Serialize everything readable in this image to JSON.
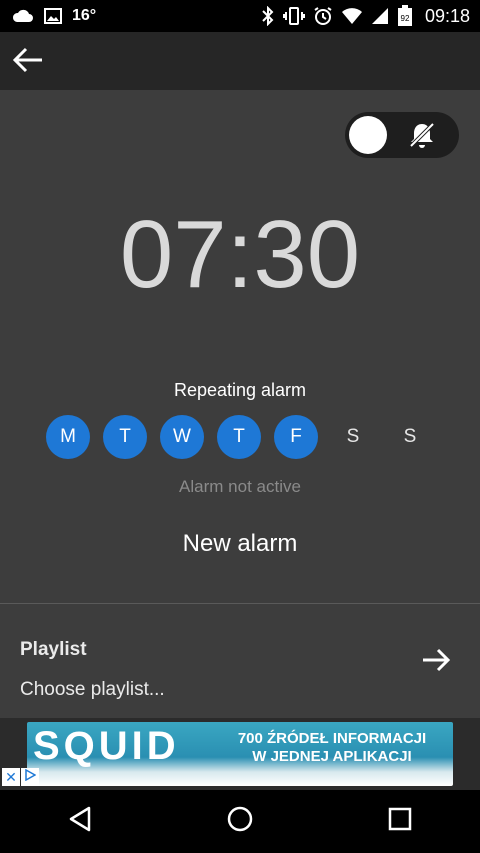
{
  "status_bar": {
    "temperature": "16°",
    "time": "09:18",
    "battery_level": "92"
  },
  "header": {
    "back_icon": "arrow-left-icon"
  },
  "alarm": {
    "enabled": false,
    "toggle_icon": "bell-off-icon",
    "time": "07:30",
    "repeat_label": "Repeating alarm",
    "days": [
      {
        "label": "M",
        "active": true
      },
      {
        "label": "T",
        "active": true
      },
      {
        "label": "W",
        "active": true
      },
      {
        "label": "T",
        "active": true
      },
      {
        "label": "F",
        "active": true
      },
      {
        "label": "S",
        "active": false
      },
      {
        "label": "S",
        "active": false
      }
    ],
    "status": "Alarm not active",
    "name": "New alarm",
    "accent_color": "#1e78d6"
  },
  "playlist": {
    "title": "Playlist",
    "value": "Choose playlist...",
    "arrow_icon": "arrow-right-icon"
  },
  "ad": {
    "brand": "SQUID",
    "text_line1": "700 ŹRÓDEŁ INFORMACJI",
    "text_line2": "W JEDNEJ APLIKACJI"
  },
  "nav": {
    "back_icon": "triangle-back-icon",
    "home_icon": "circle-home-icon",
    "recents_icon": "square-recents-icon"
  }
}
